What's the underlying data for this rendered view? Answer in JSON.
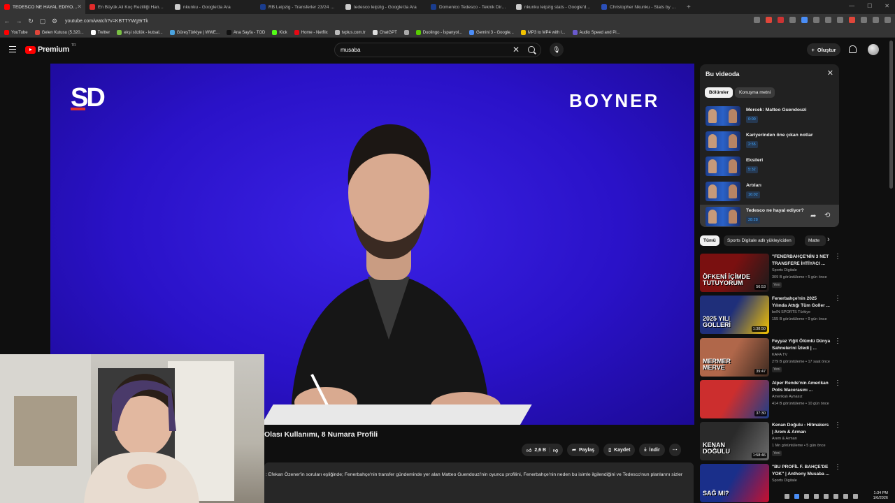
{
  "browser": {
    "tabs": [
      {
        "title": "TEDESCO NE HAYAL EDİYOR? | G",
        "color": "#ff0000",
        "active": true
      },
      {
        "title": "En Büyük Ali Koç Rezilliği Hangisidir",
        "color": "#e02b2b",
        "active": false
      },
      {
        "title": "nkunku - Google'da Ara",
        "color": "#cccccc",
        "active": false
      },
      {
        "title": "RB Leipzig - Transferler 23/24 | Trans",
        "color": "#1a3d8f",
        "active": false
      },
      {
        "title": "tedesco leipzig - Google'da Ara",
        "color": "#cccccc",
        "active": false
      },
      {
        "title": "Domenico Tedesco - Teknik Direktör",
        "color": "#1a3d8f",
        "active": false
      },
      {
        "title": "nkunku leipzig stats - Google'da Ara",
        "color": "#cccccc",
        "active": false
      },
      {
        "title": "Christopher Nkunku - Stats by club |",
        "color": "#2b4fb8",
        "active": false
      }
    ],
    "url": "youtube.com/watch?v=KBTTYWg9rTk",
    "bookmarks": [
      {
        "label": "YouTube",
        "color": "#ff0000"
      },
      {
        "label": "Gelen Kutusu (5.320...",
        "color": "#e0463a"
      },
      {
        "label": "Twitter",
        "color": "#ffffff"
      },
      {
        "label": "ekşi sözlük - kutsal...",
        "color": "#7ac143"
      },
      {
        "label": "GüreşTürkiye | WWE...",
        "color": "#4aa3df"
      },
      {
        "label": "Ana Sayfa - TOD",
        "color": "#111111"
      },
      {
        "label": "Kick",
        "color": "#53fc18"
      },
      {
        "label": "Home - Netflix",
        "color": "#e50914"
      },
      {
        "label": "tvplus.com.tr",
        "color": "#bbbbbb"
      },
      {
        "label": "ChatGPT",
        "color": "#dddddd"
      },
      {
        "label": "",
        "color": "#aaaaaa"
      },
      {
        "label": "Duolingo - İspanyol...",
        "color": "#58cc02"
      },
      {
        "label": "Gemini 3 - Google...",
        "color": "#4c8df6"
      },
      {
        "label": "MP3 to MP4 with I...",
        "color": "#f2c200"
      },
      {
        "label": "Audio Speed and Pi...",
        "color": "#6a5acd"
      }
    ]
  },
  "youtube": {
    "logo_text": "Premium",
    "logo_region": "TR",
    "search_value": "musaba",
    "create_label": "Oluştur"
  },
  "video": {
    "brand_left": "SD",
    "brand_right": "BOYNER",
    "title": "Olası Kullanımı, 8 Numara Profili",
    "likes": "2,6 B",
    "share_label": "Paylaş",
    "save_label": "Kaydet",
    "download_label": "İndir",
    "description": ": Efekan Özener'in soruları eşliğinde; Fenerbahçe'nin transfer gündeminde yer alan Matteo Guendouzi'nin oyuncu profilini, Fenerbahçe'nin neden bu isimle ilgilendiğini ve Tedesco'nun planlarını sizler"
  },
  "chapters_panel": {
    "title": "Bu videoda",
    "chip_sections": "Bölümler",
    "chip_transcript": "Konuşma metni",
    "items": [
      {
        "title": "Mercek: Matteo Guendouzi",
        "time": "0:00"
      },
      {
        "title": "Kariyerinden öne çıkan notlar",
        "time": "2:55"
      },
      {
        "title": "Eksileri",
        "time": "5:32"
      },
      {
        "title": "Artıları",
        "time": "16:02"
      },
      {
        "title": "Tedesco ne hayal ediyor?",
        "time": "28:28"
      }
    ]
  },
  "filters": {
    "all": "Tümü",
    "uploader": "Sports Digitale adlı yükleyiciden",
    "more": "Matte"
  },
  "recommendations": [
    {
      "title": "\"FENERBAHÇE'NİN 3 NET TRANSFERE İHTİYACI ...",
      "channel": "Sports Digitale",
      "meta": "309 B görüntüleme • 5 gün önce",
      "badge": "Yeni",
      "duration": "56:53",
      "thumb_a": "#7a1010",
      "thumb_b": "#1b1b1b",
      "thumb_text": "ÖFKENİ İÇİMDE TUTUYORUM"
    },
    {
      "title": "Fenerbahçe'nin 2025 Yılında Attığı Tüm Goller ...",
      "channel": "beIN SPORTS Türkiye",
      "meta": "155 B görüntüleme • 9 gün önce",
      "badge": "",
      "duration": "1:38:50",
      "thumb_a": "#1f2f7a",
      "thumb_b": "#f5c400",
      "thumb_text": "2025 YILI GOLLERİ"
    },
    {
      "title": "Feyyaz Yiğit Ölümlü Dünya Sahnelerini İzledi | ...",
      "channel": "KAFA TV",
      "meta": "279 B görüntüleme • 17 saat önce",
      "badge": "Yeni",
      "duration": "39:47",
      "thumb_a": "#b0674a",
      "thumb_b": "#3d2a20",
      "thumb_text": "MERMER MERVE"
    },
    {
      "title": "Alper Rende'nin Amerikan Polis Macerasını ...",
      "channel": "Amerikalı Aynasız",
      "meta": "414 B görüntüleme • 10 gün önce",
      "badge": "",
      "duration": "37:30",
      "thumb_a": "#cc2e2e",
      "thumb_b": "#1b3f8a",
      "thumb_text": ""
    },
    {
      "title": "Kenan Doğulu - Hitmakers | Arem & Arman",
      "channel": "Arem & Arman",
      "meta": "1 Mn görüntüleme • 5 gün önce",
      "badge": "Yeni",
      "duration": "1:58:46",
      "thumb_a": "#2a2a2a",
      "thumb_b": "#6b6b6b",
      "thumb_text": "KENAN DOĞULU"
    },
    {
      "title": "\"BU PROFİL F. BAHÇE'DE YOK\" | Anthony Musaba ...",
      "channel": "Sports Digitale",
      "meta": "",
      "badge": "",
      "duration": "",
      "thumb_a": "#1a2f8a",
      "thumb_b": "#c8102e",
      "thumb_text": "SAĞ MI?"
    }
  ],
  "system": {
    "time": "1:34 PM",
    "date": "1/6/2026"
  }
}
